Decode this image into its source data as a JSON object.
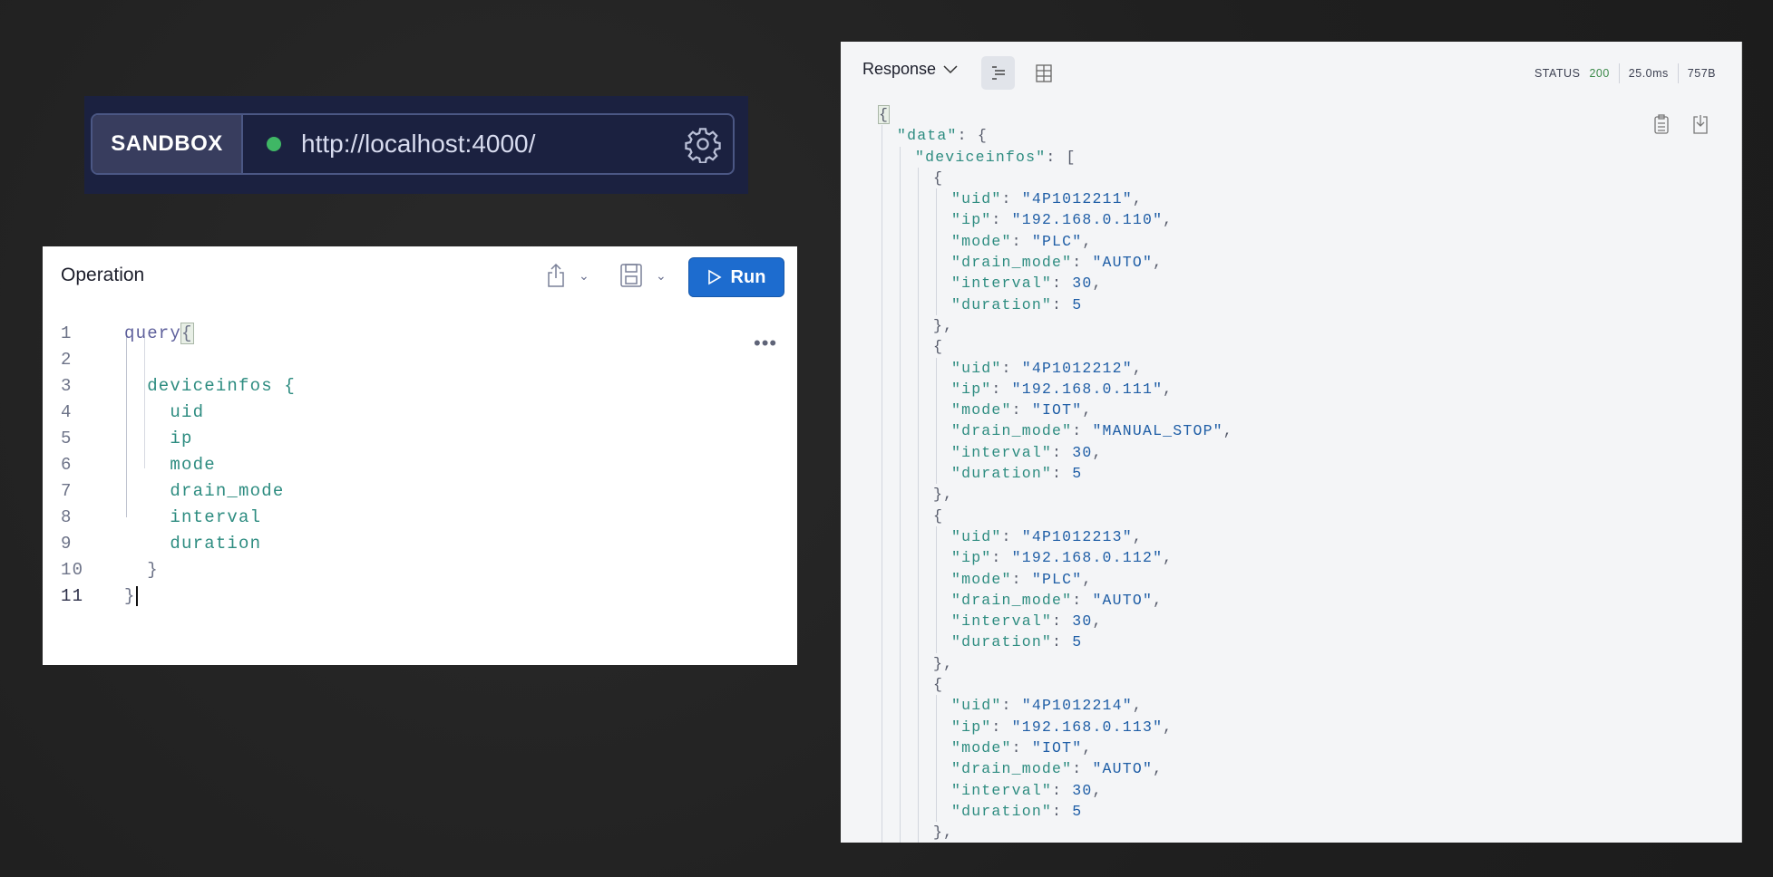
{
  "sandbox": {
    "label": "SANDBOX",
    "url": "http://localhost:4000/",
    "status_color": "#3fb765",
    "settings_icon": "gear-icon"
  },
  "operation": {
    "title": "Operation",
    "run_label": "Run",
    "share_icon": "share-icon",
    "save_icon": "save-icon",
    "more_icon": "more-icon",
    "lines": [
      {
        "n": "1",
        "text": "query",
        "brace": "{"
      },
      {
        "n": "2",
        "text": ""
      },
      {
        "n": "3",
        "text": "  deviceinfos {"
      },
      {
        "n": "4",
        "text": "    uid"
      },
      {
        "n": "5",
        "text": "    ip"
      },
      {
        "n": "6",
        "text": "    mode"
      },
      {
        "n": "7",
        "text": "    drain_mode"
      },
      {
        "n": "8",
        "text": "    interval"
      },
      {
        "n": "9",
        "text": "    duration"
      },
      {
        "n": "10",
        "text": "  }"
      },
      {
        "n": "11",
        "text": "}"
      }
    ]
  },
  "response": {
    "title": "Response",
    "status_label": "STATUS",
    "status_code": "200",
    "time": "25.0ms",
    "size": "757B",
    "root_key": "\"data\"",
    "list_key": "\"deviceinfos\"",
    "items": [
      {
        "uid": "\"4P1012211\"",
        "ip": "\"192.168.0.110\"",
        "mode": "\"PLC\"",
        "drain_mode": "\"AUTO\"",
        "interval": "30",
        "duration": "5"
      },
      {
        "uid": "\"4P1012212\"",
        "ip": "\"192.168.0.111\"",
        "mode": "\"IOT\"",
        "drain_mode": "\"MANUAL_STOP\"",
        "interval": "30",
        "duration": "5"
      },
      {
        "uid": "\"4P1012213\"",
        "ip": "\"192.168.0.112\"",
        "mode": "\"PLC\"",
        "drain_mode": "\"AUTO\"",
        "interval": "30",
        "duration": "5"
      },
      {
        "uid": "\"4P1012214\"",
        "ip": "\"192.168.0.113\"",
        "mode": "\"IOT\"",
        "drain_mode": "\"AUTO\"",
        "interval": "30",
        "duration": "5"
      }
    ]
  }
}
